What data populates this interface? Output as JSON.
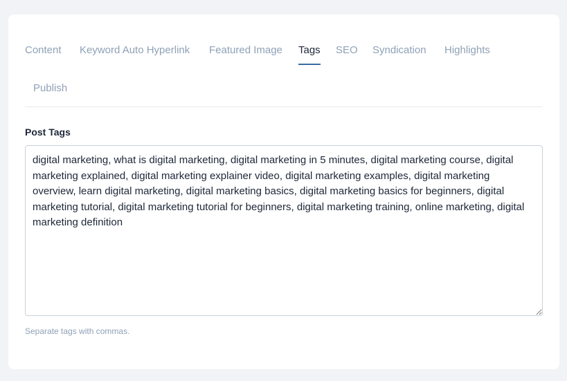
{
  "tabs": [
    {
      "label": "Content"
    },
    {
      "label": "Keyword Auto Hyperlink"
    },
    {
      "label": "Featured Image"
    },
    {
      "label": "Tags",
      "active": true
    },
    {
      "label": "SEO"
    },
    {
      "label": "Syndication"
    },
    {
      "label": "Highlights"
    },
    {
      "label": "Publish"
    }
  ],
  "post_tags": {
    "label": "Post Tags",
    "value": "digital marketing, what is digital marketing, digital marketing in 5 minutes, digital marketing course, digital marketing explained, digital marketing explainer video, digital marketing examples, digital marketing overview, learn digital marketing, digital marketing basics, digital marketing basics for beginners, digital marketing tutorial, digital marketing tutorial for beginners, digital marketing training, online marketing, digital marketing definition",
    "help": "Separate tags with commas."
  },
  "colors": {
    "accent": "#3a6ba5",
    "tab_inactive": "#8fa1b6",
    "text": "#1d2738"
  }
}
